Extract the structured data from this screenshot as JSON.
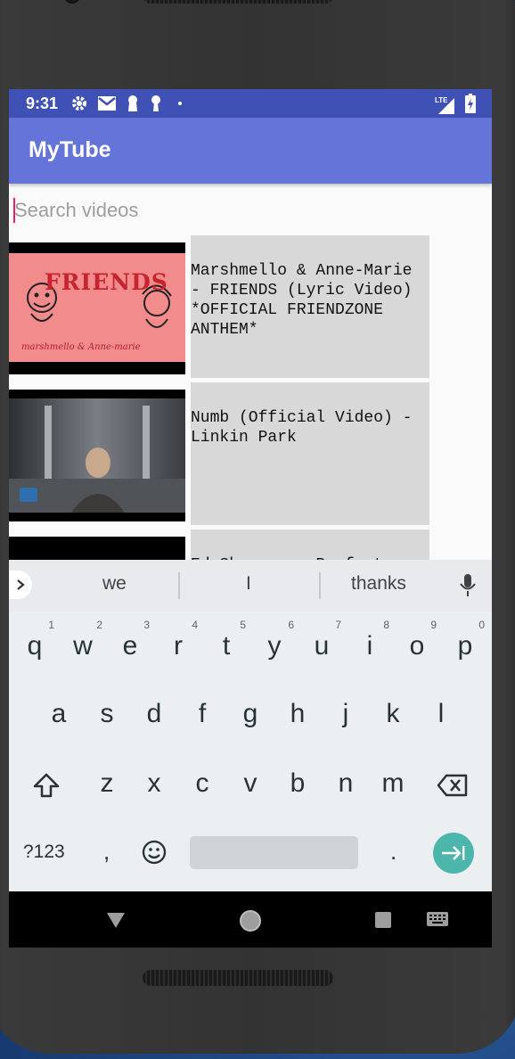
{
  "status_bar": {
    "time": "9:31",
    "icons_left": [
      "gear-icon",
      "gmail-icon",
      "keyhole-icon",
      "keyhole-icon",
      "dot-icon"
    ],
    "icons_right": [
      "lte-signal-icon",
      "battery-charging-icon"
    ],
    "lte_label": "LTE"
  },
  "app_bar": {
    "title": "MyTube"
  },
  "search": {
    "placeholder": "Search videos",
    "value": ""
  },
  "videos": [
    {
      "title": "Marshmello & Anne-Marie - FRIENDS (Lyric Video) *OFFICIAL FRIENDZONE ANTHEM*",
      "thumbnail_text": "FRIENDS",
      "thumbnail_caption": "marshmello & Anne-marie"
    },
    {
      "title": "Numb (Official Video) - Linkin Park"
    },
    {
      "title": "Ed Sheeran - Perfect"
    }
  ],
  "keyboard": {
    "suggestions": [
      "we",
      "I",
      "thanks"
    ],
    "row1": [
      {
        "key": "q",
        "hint": "1"
      },
      {
        "key": "w",
        "hint": "2"
      },
      {
        "key": "e",
        "hint": "3"
      },
      {
        "key": "r",
        "hint": "4"
      },
      {
        "key": "t",
        "hint": "5"
      },
      {
        "key": "y",
        "hint": "6"
      },
      {
        "key": "u",
        "hint": "7"
      },
      {
        "key": "i",
        "hint": "8"
      },
      {
        "key": "o",
        "hint": "9"
      },
      {
        "key": "p",
        "hint": "0"
      }
    ],
    "row2": [
      "a",
      "s",
      "d",
      "f",
      "g",
      "h",
      "j",
      "k",
      "l"
    ],
    "row3": [
      "z",
      "x",
      "c",
      "v",
      "b",
      "n",
      "m"
    ],
    "symbols_label": "?123",
    "comma_label": ",",
    "period_label": "."
  },
  "colors": {
    "status_bar": "#3f51b5",
    "app_bar": "#6574d8",
    "accent_cursor": "#e91e63",
    "enter_key": "#4db6ac"
  }
}
